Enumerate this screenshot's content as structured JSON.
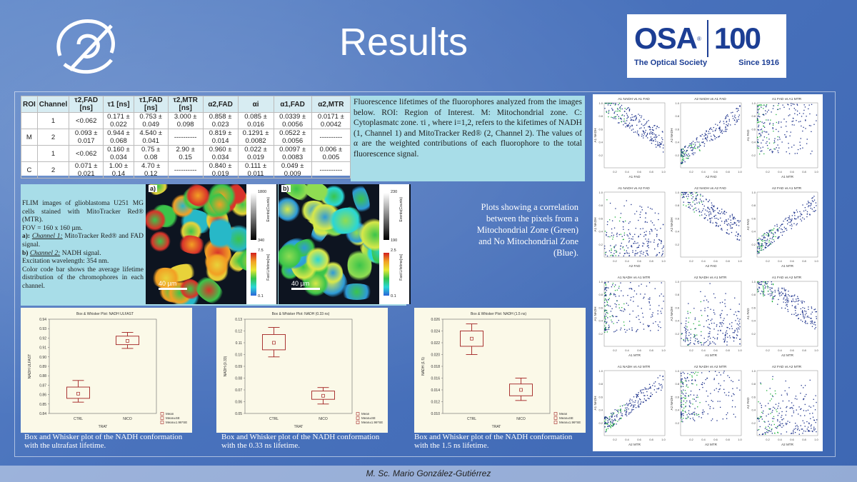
{
  "slide": {
    "title": "Results",
    "author": "M. Sc. Mario González-Gutiérrez"
  },
  "osa_logo": {
    "wordmark": "OSA",
    "registered": "®",
    "hundred": "100",
    "tagline": "The Optical Society",
    "since": "Since 1916"
  },
  "colors": {
    "background": "#4a73bd",
    "panel_cyan": "#a8dde8",
    "osa_blue": "#1c3e94",
    "box_red": "#a12020",
    "scatter_green": "#1fb23c",
    "scatter_blue": "#1a2f8a"
  },
  "lifetime_table": {
    "headers": [
      "ROI",
      "Channel",
      "τ2,FAD [ns]",
      "τ1 [ns]",
      "τ1,FAD [ns]",
      "τ2,MTR [ns]",
      "α2,FAD",
      "αi",
      "α1,FAD",
      "α2,MTR"
    ],
    "rows": [
      [
        "",
        "1",
        "<0.062",
        "0.171 ± 0.022",
        "0.753 ± 0.049",
        "3.000 ± 0.098",
        "0.858 ± 0.023",
        "0.085 ± 0.016",
        "0.0339 ± 0.0056",
        "0.0171 ± 0.0042"
      ],
      [
        "M",
        "2",
        "0.093 ± 0.017",
        "0.944 ± 0.068",
        "4.540 ± 0.041",
        "----------",
        "0.819 ± 0.014",
        "0.1291 ± 0.0082",
        "0.0522 ± 0.0056",
        "----------"
      ],
      [
        "",
        "1",
        "<0.062",
        "0.160 ± 0.034",
        "0.75 ± 0.08",
        "2.90 ± 0.15",
        "0.960 ± 0.034",
        "0.022 ± 0.019",
        "0.0097 ± 0.0083",
        "0.006 ± 0.005"
      ],
      [
        "C",
        "2",
        "0.071 ± 0.021",
        "1.00 ± 0.14",
        "4.70 ± 0.12",
        "----------",
        "0.840 ± 0.019",
        "0.111 ± 0.011",
        "0.049 ± 0.009",
        "----------"
      ]
    ]
  },
  "table_caption": "Fluorescence lifetimes of the fluorophores analyzed from the images below. ROI: Region of Interest. M: Mitochondrial zone. C: Cytoplasmatc zone. τi , where i=1,2, refers to the kifetimes of NADH (1, Channel 1) and MitoTracker Red® (2, Channel 2). The values of α are the weighted contributions of each fluorophore to the total fluorescence signal.",
  "flim": {
    "line1": "FLIM images of glioblastoma U251 MG cells stained with MitoTracker Red® (MTR).",
    "line2": "FOV = 160 x 160 µm.",
    "a_label": "a):",
    "a_channel": "Channel 1:",
    "a_text": "MitoTracker Red® and FAD signal.",
    "b_label": "b)",
    "b_channel": "Channel 2:",
    "b_text": "NADH signal.",
    "line5": "Excitation wavelength: 354 nm.",
    "line6": "Color code bar shows the average lifetime distribution of the chromophores in each channel.",
    "image_a_label": "a)",
    "image_b_label": "b)",
    "scale_bar": "40 µm",
    "a_gray_max": "1800",
    "a_gray_min": "340",
    "a_life_max": "7.5",
    "a_life_min": "0.1",
    "b_gray_max": "230",
    "b_gray_min": "190",
    "b_life_max": "2.5",
    "b_life_min": "0.1",
    "gray_title": "Events(Counts)",
    "life_title": "Fast Lifetime[ns]"
  },
  "plots_description": "Plots showing a correlation between the pixels from a Mitochondrial Zone (Green) and No Mitochondrial Zone (Blue).",
  "box_plots": [
    {
      "title": "Box & Whisker Plot: NADH ULFAST",
      "ylabel": "NADH ULFAST",
      "xlabel": "TRAT",
      "yticks": [
        "0.94",
        "0.93",
        "0.92",
        "0.91",
        "0.90",
        "0.89",
        "0.88",
        "0.87",
        "0.86",
        "0.85",
        "0.84"
      ],
      "categories": [
        "CTRL",
        "NICO"
      ],
      "legend": [
        "Mean",
        "Mean±SE",
        "Mean±1.96*SE"
      ],
      "caption": "Box and Whisker plot of the NADH conformation with the ultrafast lifetime."
    },
    {
      "title": "Box & Whisker Plot: NADH (0.33 ns)",
      "ylabel": "NADH (0.33)",
      "xlabel": "TRAT",
      "yticks": [
        "0.13",
        "0.12",
        "0.11",
        "0.10",
        "0.09",
        "0.08",
        "0.07",
        "0.06",
        "0.05"
      ],
      "categories": [
        "CTRL",
        "NICO"
      ],
      "legend": [
        "Mean",
        "Mean±SE",
        "Mean±1.96*SE"
      ],
      "caption": "Box and Whisker plot of the NADH conformation with the 0.33 ns lifetime."
    },
    {
      "title": "Box & Whisker Plot: NADH (1.5 ns)",
      "ylabel": "NADH (1.5)",
      "xlabel": "TRAT",
      "yticks": [
        "0.026",
        "0.024",
        "0.022",
        "0.020",
        "0.018",
        "0.016",
        "0.014",
        "0.012",
        "0.010"
      ],
      "categories": [
        "CTRL",
        "NICO"
      ],
      "legend": [
        "Mean",
        "Mean±SE",
        "Mean±1.96*SE"
      ],
      "caption": "Box and Whisker plot of the NADH conformation with the 1.5 ns lifetime."
    }
  ],
  "chart_data": [
    {
      "type": "box",
      "title": "Box & Whisker Plot: NADH ULFAST",
      "xlabel": "TRAT",
      "ylabel": "NADH ULFAST",
      "ylim": [
        0.84,
        0.94
      ],
      "categories": [
        "CTRL",
        "NICO"
      ],
      "mean": [
        0.861,
        0.917
      ],
      "se_low": [
        0.856,
        0.913
      ],
      "se_high": [
        0.868,
        0.922
      ],
      "ci_low": [
        0.852,
        0.909
      ],
      "ci_high": [
        0.875,
        0.926
      ]
    },
    {
      "type": "box",
      "title": "Box & Whisker Plot: NADH (0.33 ns)",
      "xlabel": "TRAT",
      "ylabel": "NADH (0.33)",
      "ylim": [
        0.05,
        0.13
      ],
      "categories": [
        "CTRL",
        "NICO"
      ],
      "mean": [
        0.11,
        0.065
      ],
      "se_low": [
        0.104,
        0.062
      ],
      "se_high": [
        0.117,
        0.069
      ],
      "ci_low": [
        0.098,
        0.058
      ],
      "ci_high": [
        0.123,
        0.072
      ]
    },
    {
      "type": "box",
      "title": "Box & Whisker Plot: NADH (1.5 ns)",
      "xlabel": "TRAT",
      "ylabel": "NADH (1.5)",
      "ylim": [
        0.01,
        0.026
      ],
      "categories": [
        "CTRL",
        "NICO"
      ],
      "mean": [
        0.0227,
        0.014
      ],
      "se_low": [
        0.0214,
        0.013
      ],
      "se_high": [
        0.024,
        0.015
      ],
      "ci_low": [
        0.02,
        0.0122
      ],
      "ci_high": [
        0.0252,
        0.016
      ]
    },
    {
      "type": "scatter",
      "panels": [
        {
          "title": "A1 NADH vs A1 FAD",
          "xlabel": "A1 FAD",
          "ylabel": "A1 NADH"
        },
        {
          "title": "A2 NADH vs A1 FAD",
          "xlabel": "A2 FAD",
          "ylabel": "A2 NADH"
        },
        {
          "title": "A1 FAD vs A1 MTR",
          "xlabel": "A1 MTR",
          "ylabel": "A1 FAD"
        },
        {
          "title": "A1 NADH vs A2 FAD",
          "xlabel": "A2 FAD",
          "ylabel": "A1 NADH"
        },
        {
          "title": "A2 NADH vs A2 FAD",
          "xlabel": "A2 FAD",
          "ylabel": "A2 NADH"
        },
        {
          "title": "A2 FAD vs A1 MTR",
          "xlabel": "A1 MTR",
          "ylabel": "A2 FAD"
        },
        {
          "title": "A1 NADH vs A1 MTR",
          "xlabel": "A1 MTR",
          "ylabel": "A1 NADH"
        },
        {
          "title": "A2 NADH vs A1 MTR",
          "xlabel": "A1 MTR",
          "ylabel": "A2 NADH"
        },
        {
          "title": "A1 FAD vs A2 MTR",
          "xlabel": "A2 MTR",
          "ylabel": "A1 FAD"
        },
        {
          "title": "A1 NADH vs A2 MTR",
          "xlabel": "A2 MTR",
          "ylabel": "A1 NADH"
        },
        {
          "title": "A2 NADH vs A2 MTR",
          "xlabel": "A2 MTR",
          "ylabel": "A2 NADH"
        },
        {
          "title": "A2 FAD vs A2 MTR",
          "xlabel": "A2 MTR",
          "ylabel": "A2 FAD"
        }
      ],
      "xticks": [
        "0.2",
        "0.4",
        "0.6",
        "0.8",
        "1.0"
      ],
      "yticks": [
        "0.2",
        "0.4",
        "0.6",
        "0.8",
        "1.0"
      ]
    }
  ]
}
